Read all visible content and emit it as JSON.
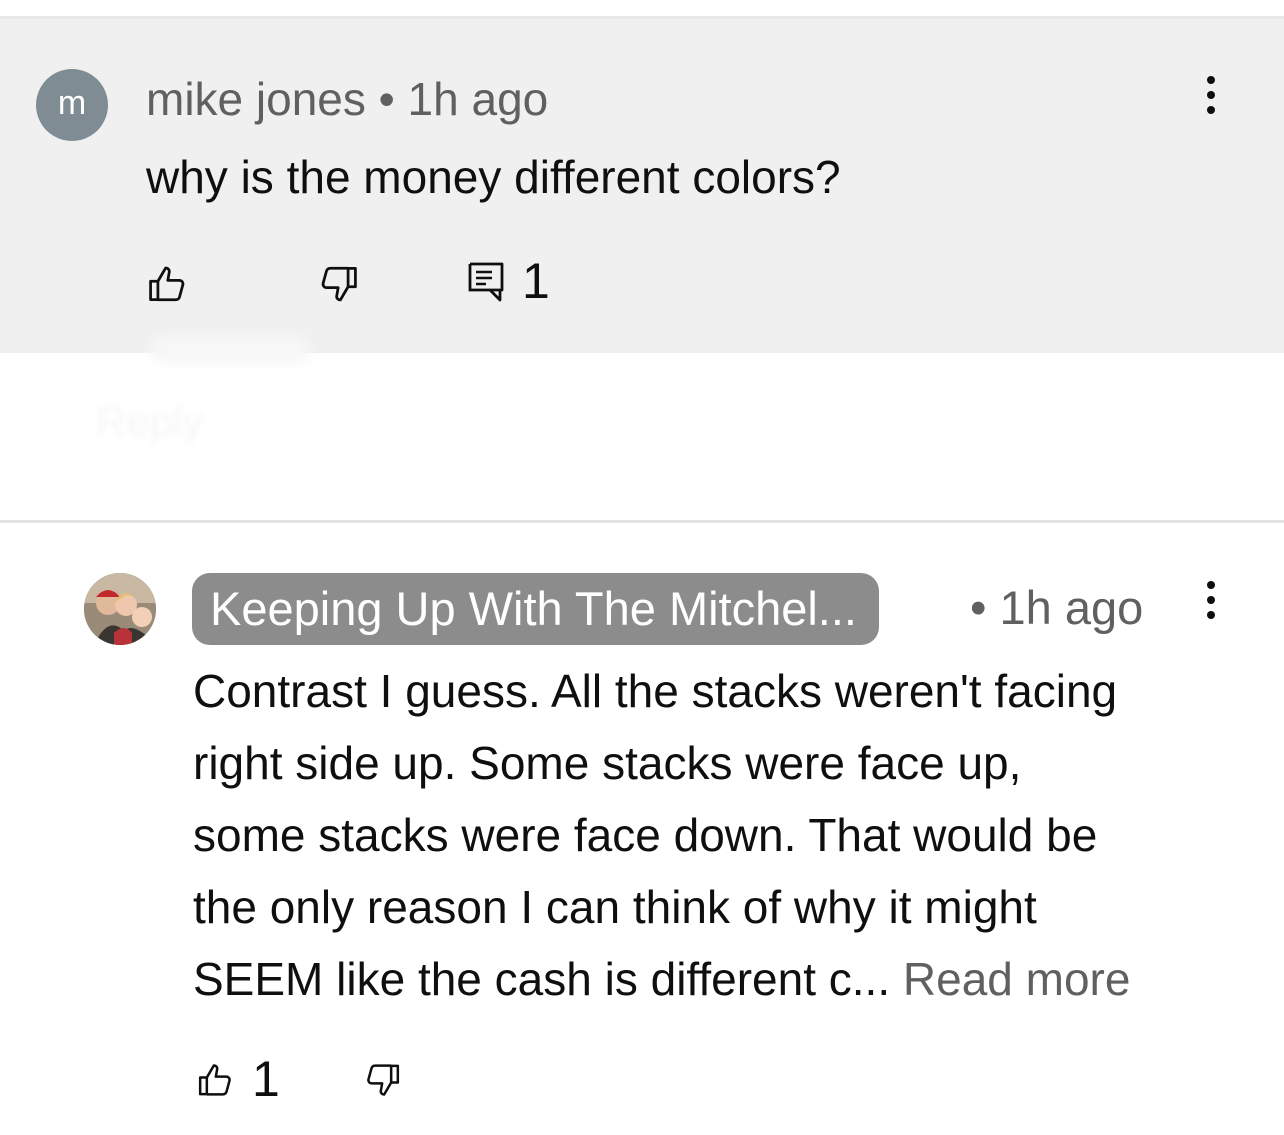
{
  "comment": {
    "avatar_letter": "m",
    "author": "mike jones",
    "separator": " • ",
    "time": "1h ago",
    "text": "why is the money different colors?",
    "reply_count": "1",
    "icons": [
      "thumbs-up-icon",
      "thumbs-down-icon",
      "comment-icon",
      "more-vert-icon"
    ]
  },
  "faded_reply_label": "Reply",
  "reply": {
    "author": "Keeping Up With The Mitchel...",
    "separator": " • ",
    "time": "1h ago",
    "lines": [
      "Contrast I guess. All the stacks weren't facing",
      "right side up. Some stacks were face up,",
      "some stacks were face down. That would be",
      "the only reason I can think of why it might",
      "SEEM like the cash is different c..."
    ],
    "read_more": "Read more",
    "like_count": "1",
    "icons": [
      "thumbs-up-icon",
      "thumbs-down-icon",
      "more-vert-icon"
    ]
  },
  "colors": {
    "highlight_bg": "#f0f0f0",
    "author_chip_bg": "#8c8c8c",
    "secondary_text": "#606060",
    "primary_text": "#0f0f0f"
  }
}
